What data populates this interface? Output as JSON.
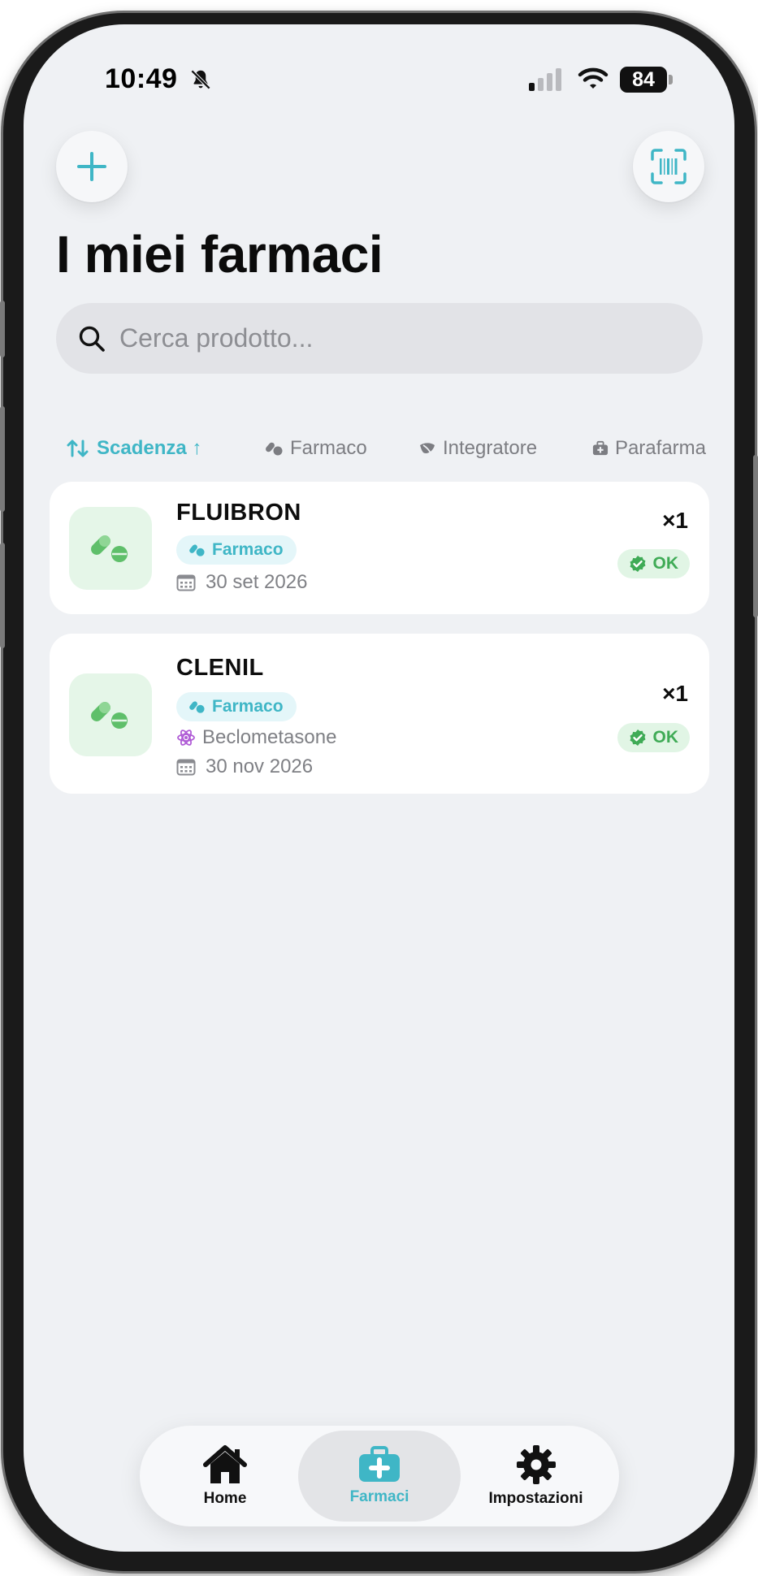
{
  "status_bar": {
    "time": "10:49",
    "battery": "84"
  },
  "header": {
    "title": "I miei farmaci"
  },
  "search": {
    "placeholder": "Cerca prodotto..."
  },
  "filters": [
    {
      "label": "Scadenza ↑",
      "active": true,
      "icon": "sort-icon"
    },
    {
      "label": "Farmaco",
      "active": false,
      "icon": "pills-icon"
    },
    {
      "label": "Integratore",
      "active": false,
      "icon": "leaf-icon"
    },
    {
      "label": "Parafarma",
      "active": false,
      "icon": "medkit-icon"
    }
  ],
  "products": [
    {
      "name": "FLUIBRON",
      "category": "Farmaco",
      "expiry": "30 set 2026",
      "quantity": "×1",
      "status": "OK"
    },
    {
      "name": "CLENIL",
      "category": "Farmaco",
      "ingredient": "Beclometasone",
      "expiry": "30 nov 2026",
      "quantity": "×1",
      "status": "OK"
    }
  ],
  "tabbar": [
    {
      "label": "Home",
      "icon": "home-icon",
      "active": false
    },
    {
      "label": "Farmaci",
      "icon": "medkit-icon",
      "active": true
    },
    {
      "label": "Impostazioni",
      "icon": "gear-icon",
      "active": false
    }
  ],
  "colors": {
    "accent": "#3fb6c6",
    "ok_green": "#3fab56",
    "background": "#eff1f4"
  }
}
